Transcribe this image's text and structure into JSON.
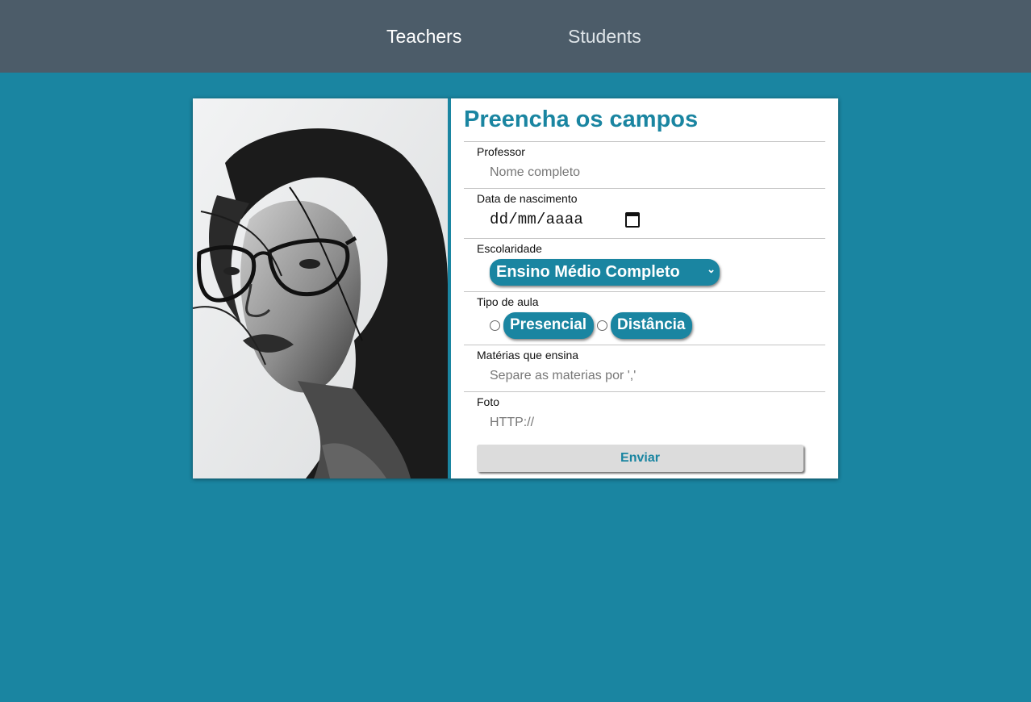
{
  "nav": {
    "teachers_label": "Teachers",
    "students_label": "Students",
    "active": "Teachers"
  },
  "form": {
    "title": "Preencha os campos",
    "professor": {
      "label": "Professor",
      "placeholder": "Nome completo"
    },
    "nascimento": {
      "label": "Data de nascimento",
      "value": "dd/mm/aaaa"
    },
    "escolaridade": {
      "label": "Escolaridade",
      "selected": "Ensino Médio Completo"
    },
    "tipo_aula": {
      "label": "Tipo de aula",
      "options": [
        "Presencial",
        "Distância"
      ]
    },
    "materias": {
      "label": "Matérias que ensina",
      "placeholder": "Separe as materias por ','"
    },
    "foto": {
      "label": "Foto",
      "placeholder": "HTTP://"
    },
    "submit_label": "Enviar"
  },
  "colors": {
    "page_background": "#1a85a1",
    "nav_background": "#4c5c69",
    "accent": "#1a85a1",
    "button_background": "#dcdcdc"
  }
}
